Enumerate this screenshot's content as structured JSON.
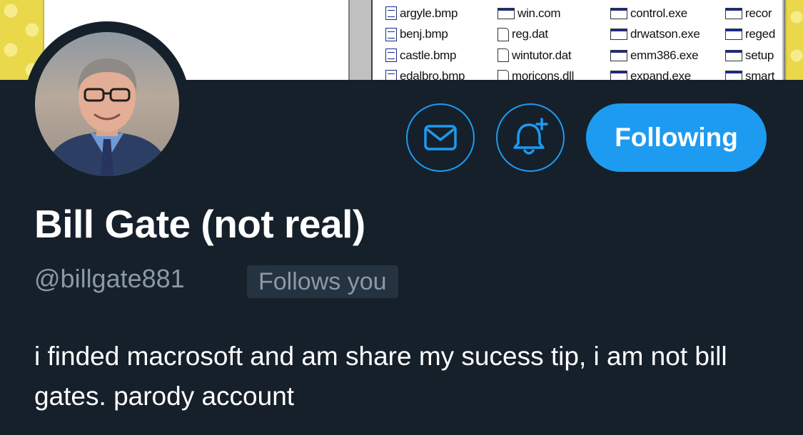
{
  "banner": {
    "columns": [
      {
        "files": [
          {
            "name": "argyle.bmp",
            "icon": "document-icon"
          },
          {
            "name": "benj.bmp",
            "icon": "document-icon"
          },
          {
            "name": "castle.bmp",
            "icon": "document-icon"
          },
          {
            "name": "edalbro.bmp",
            "icon": "document-icon"
          }
        ]
      },
      {
        "files": [
          {
            "name": "win.com",
            "icon": "program-icon"
          },
          {
            "name": "reg.dat",
            "icon": "blank-file-icon"
          },
          {
            "name": "wintutor.dat",
            "icon": "blank-file-icon"
          },
          {
            "name": "moricons.dll",
            "icon": "blank-file-icon"
          }
        ]
      },
      {
        "files": [
          {
            "name": "control.exe",
            "icon": "program-icon"
          },
          {
            "name": "drwatson.exe",
            "icon": "program-icon"
          },
          {
            "name": "emm386.exe",
            "icon": "program-icon"
          },
          {
            "name": "expand.exe",
            "icon": "program-icon"
          }
        ]
      },
      {
        "files": [
          {
            "name": "recor",
            "icon": "program-icon"
          },
          {
            "name": "reged",
            "icon": "program-icon"
          },
          {
            "name": "setup",
            "icon": "program-icon"
          },
          {
            "name": "smart",
            "icon": "program-icon"
          }
        ]
      }
    ]
  },
  "profile": {
    "display_name": "Bill Gate (not real)",
    "handle": "@billgate881",
    "follows_you_badge": "Follows you",
    "bio": "i finded macrosoft and am share my sucess tip, i am not bill gates. parody account"
  },
  "actions": {
    "message_icon": "envelope-icon",
    "notify_icon": "bell-plus-icon",
    "follow_label": "Following"
  },
  "colors": {
    "background": "#15202b",
    "accent": "#1d9bf0",
    "muted_text": "#8b98a5",
    "badge_bg": "#253341"
  }
}
